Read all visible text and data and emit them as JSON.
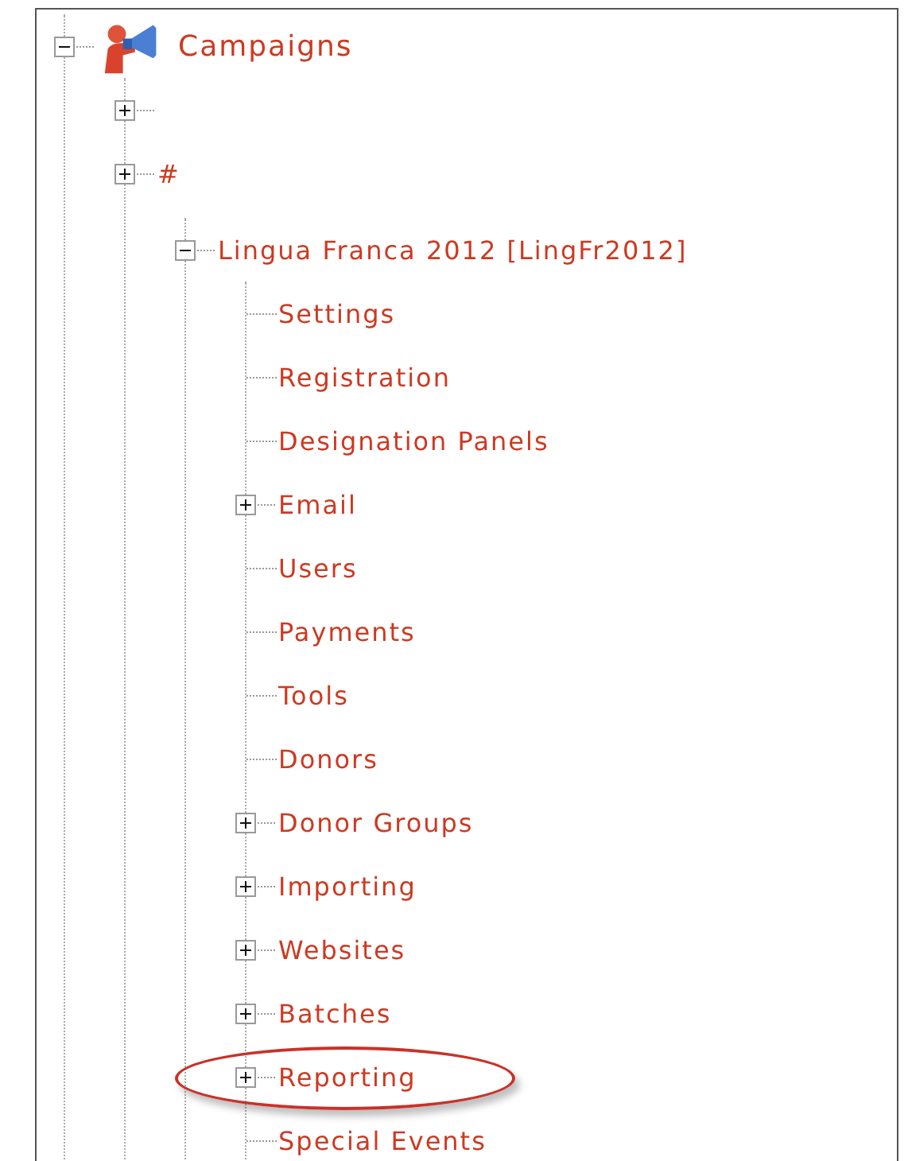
{
  "tree": [
    {
      "kind": "root",
      "label": "Campaigns",
      "expanded": true,
      "children": [
        {
          "expanded": false
        },
        {
          "label": "#",
          "expanded": false
        },
        {
          "kind": "group",
          "children": [
            {
              "label": "Lingua Franca 2012 [LingFr2012]",
              "expanded": true,
              "children": [
                {
                  "label": "Settings",
                  "highlighted": false
                },
                {
                  "label": "Registration",
                  "highlighted": false
                },
                {
                  "label": "Designation Panels",
                  "highlighted": false
                },
                {
                  "label": "Email",
                  "expanded": false,
                  "highlighted": false
                },
                {
                  "label": "Users",
                  "highlighted": false
                },
                {
                  "label": "Payments",
                  "highlighted": false
                },
                {
                  "label": "Tools",
                  "highlighted": false
                },
                {
                  "label": "Donors",
                  "highlighted": false
                },
                {
                  "label": "Donor Groups",
                  "expanded": false,
                  "highlighted": false
                },
                {
                  "label": "Importing",
                  "expanded": false,
                  "highlighted": false
                },
                {
                  "label": "Websites",
                  "expanded": false,
                  "highlighted": false
                },
                {
                  "label": "Batches",
                  "expanded": false,
                  "highlighted": false
                },
                {
                  "label": "Reporting",
                  "expanded": false,
                  "highlighted": true
                },
                {
                  "label": "Special Events",
                  "highlighted": false
                }
              ]
            }
          ]
        }
      ]
    }
  ]
}
